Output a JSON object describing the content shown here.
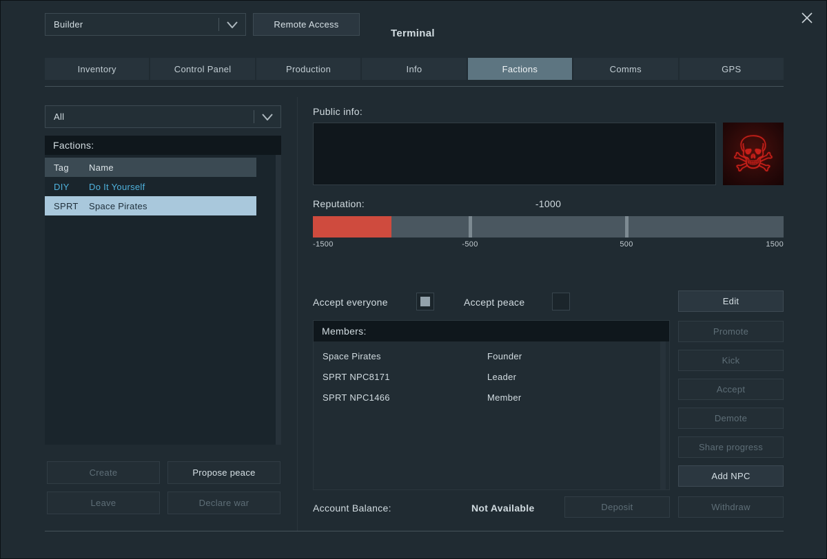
{
  "titlebar": {
    "grid_name": "Builder",
    "remote_access_label": "Remote Access",
    "window_title": "Terminal"
  },
  "tabs": [
    {
      "label": "Inventory"
    },
    {
      "label": "Control Panel"
    },
    {
      "label": "Production"
    },
    {
      "label": "Info"
    },
    {
      "label": "Factions"
    },
    {
      "label": "Comms"
    },
    {
      "label": "GPS"
    }
  ],
  "active_tab": "Factions",
  "left": {
    "filter_value": "All",
    "list_title": "Factions:",
    "col_tag": "Tag",
    "col_name": "Name",
    "factions": [
      {
        "tag": "DIY",
        "name": "Do It Yourself",
        "selected": false
      },
      {
        "tag": "SPRT",
        "name": "Space Pirates",
        "selected": true
      }
    ],
    "create_label": "Create",
    "propose_peace_label": "Propose peace",
    "leave_label": "Leave",
    "declare_war_label": "Declare war"
  },
  "right": {
    "public_info_label": "Public info:",
    "public_info_value": "",
    "faction_icon_glyph": "☠",
    "reputation_label": "Reputation:",
    "reputation_value": "-1000",
    "reputation_min": -1500,
    "reputation_max": 1500,
    "scale_labels": [
      "-1500",
      "-500",
      "500",
      "1500"
    ],
    "accept_everyone_label": "Accept everyone",
    "accept_everyone_checked": true,
    "accept_peace_label": "Accept peace",
    "accept_peace_checked": false,
    "members_title": "Members:",
    "members": [
      {
        "name": "Space Pirates",
        "role": "Founder"
      },
      {
        "name": "SPRT NPC8171",
        "role": "Leader"
      },
      {
        "name": "SPRT NPC1466",
        "role": "Member"
      }
    ],
    "buttons": {
      "edit": "Edit",
      "promote": "Promote",
      "kick": "Kick",
      "accept": "Accept",
      "demote": "Demote",
      "share_progress": "Share progress",
      "add_npc": "Add NPC"
    },
    "balance_label": "Account Balance:",
    "balance_value": "Not Available",
    "deposit_label": "Deposit",
    "withdraw_label": "Withdraw"
  }
}
